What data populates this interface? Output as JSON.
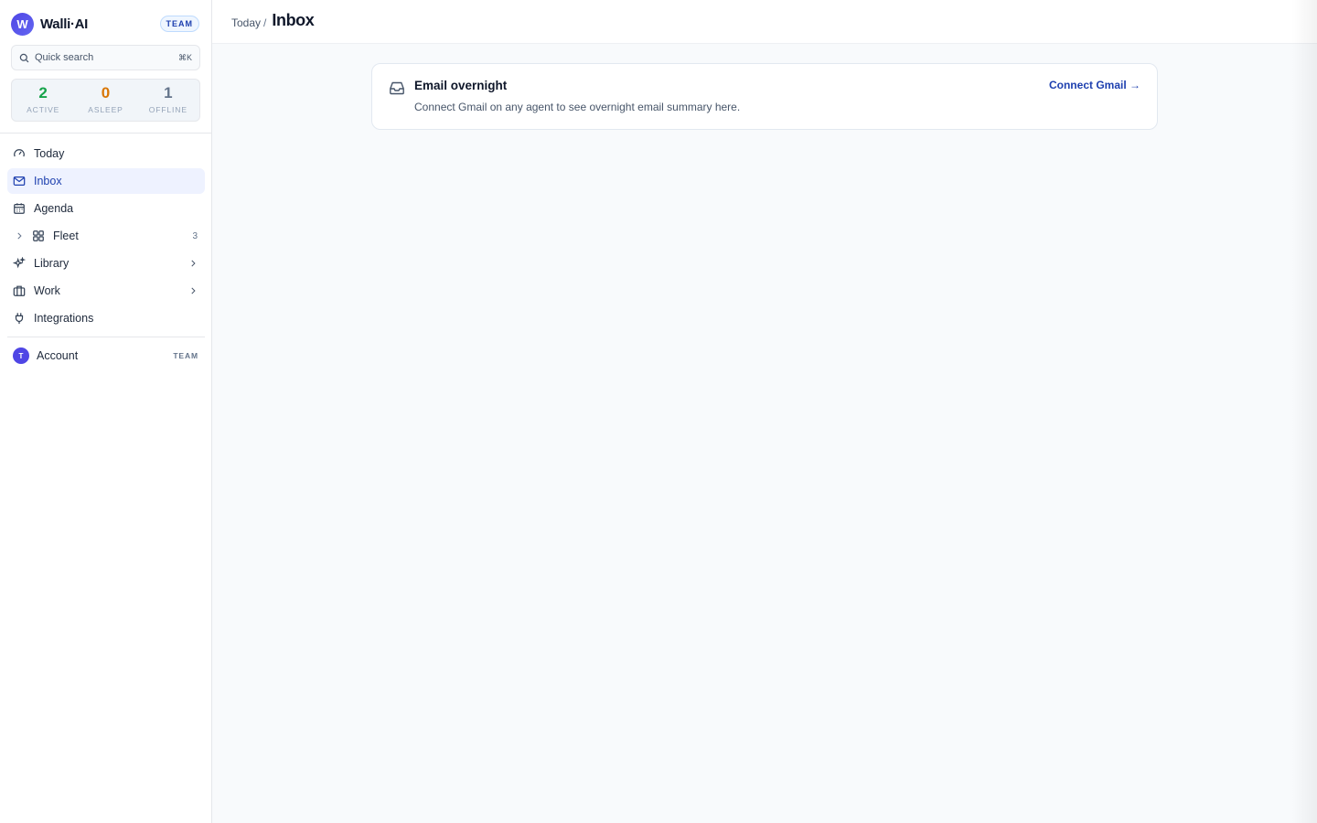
{
  "app": {
    "logo_letter": "W",
    "name": "Walli·AI",
    "plan_badge": "TEAM"
  },
  "search": {
    "placeholder": "Quick search",
    "shortcut": "⌘K",
    "icon": "search-icon"
  },
  "stats": [
    {
      "value": "2",
      "label": "ACTIVE",
      "color": "#16a34a"
    },
    {
      "value": "0",
      "label": "ASLEEP",
      "color": "#d97706"
    },
    {
      "value": "1",
      "label": "OFFLINE",
      "color": "#64748b"
    }
  ],
  "nav": [
    {
      "label": "Today",
      "icon": "gauge-icon"
    },
    {
      "label": "Inbox",
      "icon": "mail-icon",
      "active": true
    },
    {
      "label": "Agenda",
      "icon": "calendar-icon"
    },
    {
      "label": "Fleet",
      "icon": "grid-icon",
      "count": "3",
      "expand_icon": "chevron-right-icon"
    },
    {
      "label": "Library",
      "icon": "sparkles-icon",
      "chevron": "chevron-right-icon"
    },
    {
      "label": "Work",
      "icon": "briefcase-icon",
      "chevron": "chevron-right-icon"
    },
    {
      "label": "Integrations",
      "icon": "plug-icon"
    }
  ],
  "account": {
    "avatar_letter": "T",
    "label": "Account",
    "badge": "TEAM"
  },
  "header": {
    "breadcrumb": "Today",
    "separator": "/",
    "title": "Inbox"
  },
  "card": {
    "icon": "inbox-tray-icon",
    "title": "Email overnight",
    "description": "Connect Gmail on any agent to see overnight email summary here.",
    "action": "Connect Gmail →"
  }
}
